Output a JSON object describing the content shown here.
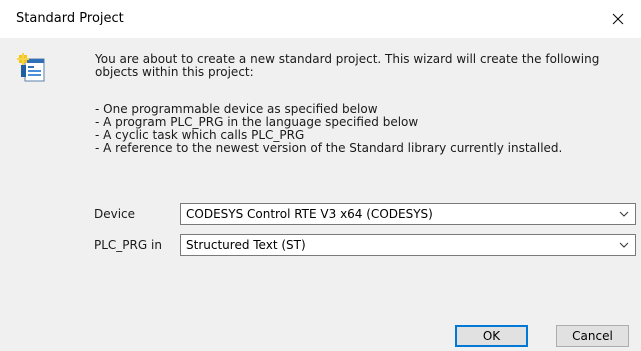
{
  "window": {
    "title": "Standard Project",
    "close_label": "close"
  },
  "message": {
    "intro": "You are about to create a new standard project. This wizard will create the following objects within this project:",
    "bullets": [
      "- One programmable device as specified below",
      "- A program PLC_PRG in the language specified below",
      "- A cyclic task which calls PLC_PRG",
      "- A reference to the newest version of the Standard library currently installed."
    ]
  },
  "fields": {
    "device": {
      "label": "Device",
      "value": "CODESYS Control RTE V3 x64 (CODESYS)"
    },
    "language": {
      "label": "PLC_PRG in",
      "value": "Structured Text (ST)"
    }
  },
  "buttons": {
    "ok": "OK",
    "cancel": "Cancel"
  },
  "icons": {
    "wizard": "new-project-wizard-icon",
    "close": "close-icon",
    "dropdown": "chevron-down-icon"
  },
  "colors": {
    "dialog_bg": "#f0f0f0",
    "titlebar_bg": "#ffffff",
    "default_button_border": "#0078d7"
  }
}
